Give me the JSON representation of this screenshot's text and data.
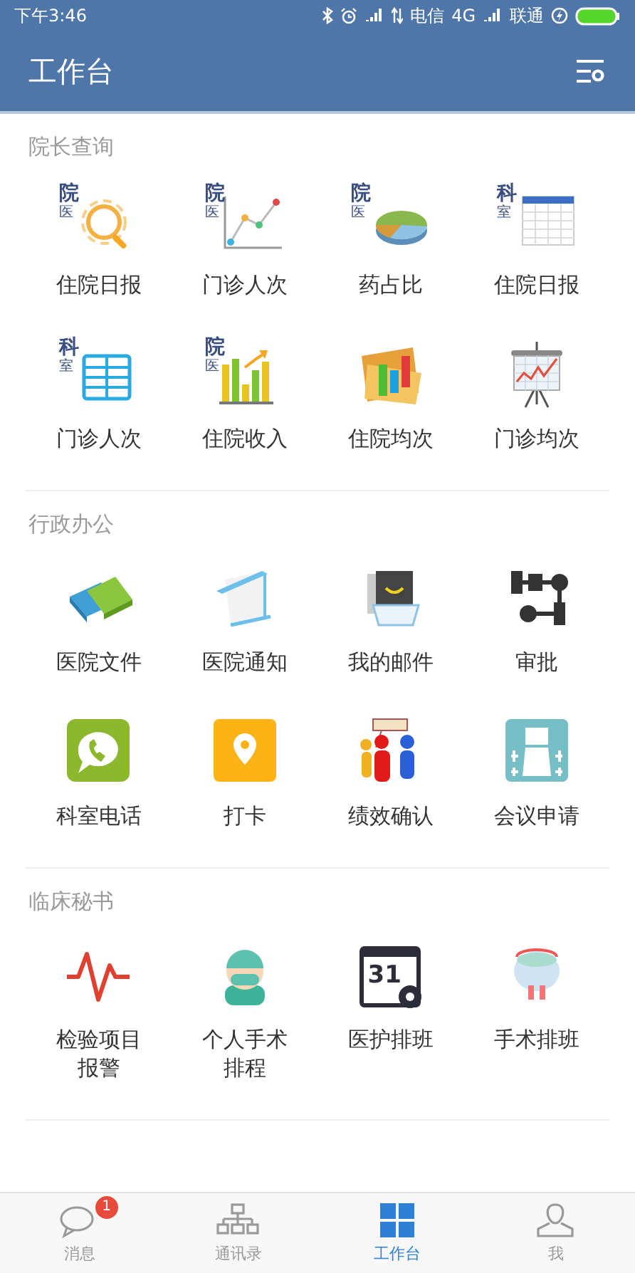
{
  "status_bar": {
    "time": "下午3:46",
    "carrier_1": "电信",
    "network": "4G",
    "carrier_2": "联通"
  },
  "header": {
    "title": "工作台"
  },
  "sections": [
    {
      "title": "院长查询",
      "items": [
        {
          "label": "住院日报",
          "tag": [
            "院",
            "医"
          ]
        },
        {
          "label": "门诊人次",
          "tag": [
            "院",
            "医"
          ]
        },
        {
          "label": "药占比",
          "tag": [
            "院",
            "医"
          ]
        },
        {
          "label": "住院日报",
          "tag": [
            "科",
            "室"
          ]
        },
        {
          "label": "门诊人次",
          "tag": [
            "科",
            "室"
          ]
        },
        {
          "label": "住院收入",
          "tag": [
            "院",
            "医"
          ]
        },
        {
          "label": "住院均次"
        },
        {
          "label": "门诊均次"
        }
      ]
    },
    {
      "title": "行政办公",
      "items": [
        {
          "label": "医院文件"
        },
        {
          "label": "医院通知"
        },
        {
          "label": "我的邮件"
        },
        {
          "label": "审批"
        },
        {
          "label": "科室电话"
        },
        {
          "label": "打卡"
        },
        {
          "label": "绩效确认"
        },
        {
          "label": "会议申请"
        }
      ]
    },
    {
      "title": "临床秘书",
      "items": [
        {
          "label": "检验项目报警"
        },
        {
          "label": "个人手术排程"
        },
        {
          "label": "医护排班",
          "icon_text": "31"
        },
        {
          "label": "手术排班"
        }
      ]
    }
  ],
  "tab_bar": [
    {
      "label": "消息",
      "selected": false,
      "badge": "1"
    },
    {
      "label": "通讯录",
      "selected": false
    },
    {
      "label": "工作台",
      "selected": true
    },
    {
      "label": "我",
      "selected": false
    }
  ]
}
